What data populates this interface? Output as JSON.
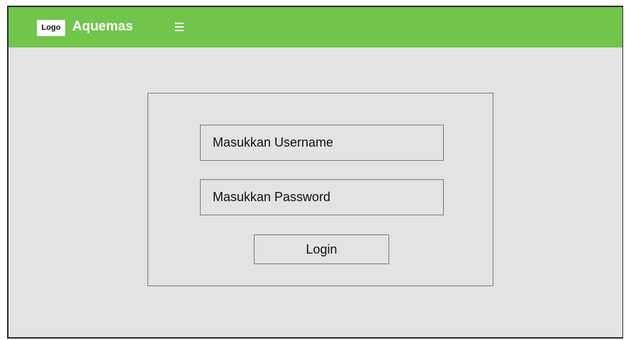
{
  "header": {
    "logo_label": "Logo",
    "brand": "Aquemas",
    "menu_icon": "hamburger-menu-icon"
  },
  "login": {
    "username_placeholder": "Masukkan Username",
    "username_value": "",
    "password_placeholder": "Masukkan Password",
    "password_value": "",
    "button_label": "Login"
  },
  "colors": {
    "header_bg": "#71c54b",
    "page_bg": "#e3e3e3",
    "border": "#7a7a7a",
    "frame_border": "#2b2b2b"
  }
}
